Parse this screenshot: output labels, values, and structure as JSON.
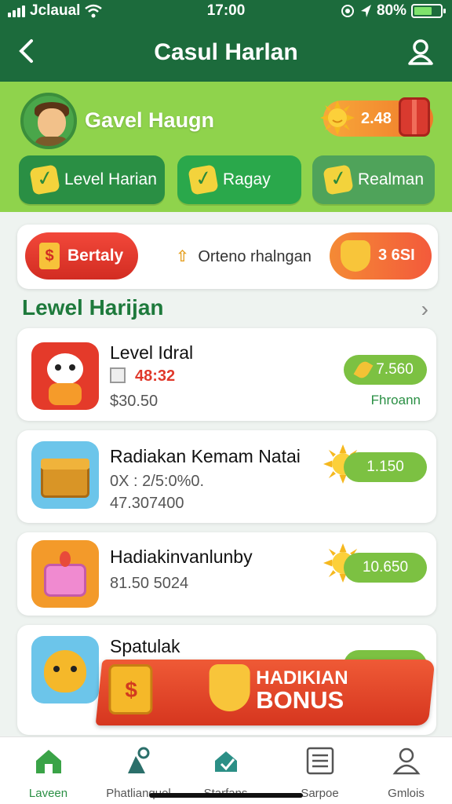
{
  "status": {
    "carrier": "Jclaual",
    "time": "17:00",
    "battery": "80%"
  },
  "header": {
    "title": "Casul Harlan"
  },
  "profile": {
    "name": "Gavel Haugn",
    "coins": "2.48"
  },
  "tabs": [
    {
      "label": "Level Harian"
    },
    {
      "label": "Ragay"
    },
    {
      "label": "Realman"
    }
  ],
  "reward": {
    "button_label": "Bertaly",
    "middle_text": "Orteno rhalngan",
    "value": "3 6SI"
  },
  "section": {
    "title": "Lewel Harijan"
  },
  "items": [
    {
      "title": "Level Idral",
      "line1": "48:32",
      "line2": "$30.50",
      "pill": "7.560",
      "caption": "Fhroann"
    },
    {
      "title": "Radiakan Kemam Natai",
      "line1": "0X : 2/5:0%0.",
      "line2": "47.307400",
      "pill": "1.150"
    },
    {
      "title": "Hadiakinvanlunby",
      "line1": "81.50 5024",
      "line2": "",
      "pill": "10.650"
    },
    {
      "title": "Spatulak",
      "line1": "",
      "line2": "",
      "pill": ""
    }
  ],
  "bonus": {
    "line1": "HADIKIAN",
    "line2": "BONUS"
  },
  "bottomnav": [
    {
      "label": "Laveen"
    },
    {
      "label": "Phatlianquel"
    },
    {
      "label": "Starfans"
    },
    {
      "label": "Sarpoe"
    },
    {
      "label": "Gmlois"
    }
  ],
  "colors": {
    "header": "#1c6b3c",
    "hero": "#8fd34c",
    "accent": "#2a8f44",
    "pill": "#7cc142",
    "bonus": "#e2472a"
  }
}
